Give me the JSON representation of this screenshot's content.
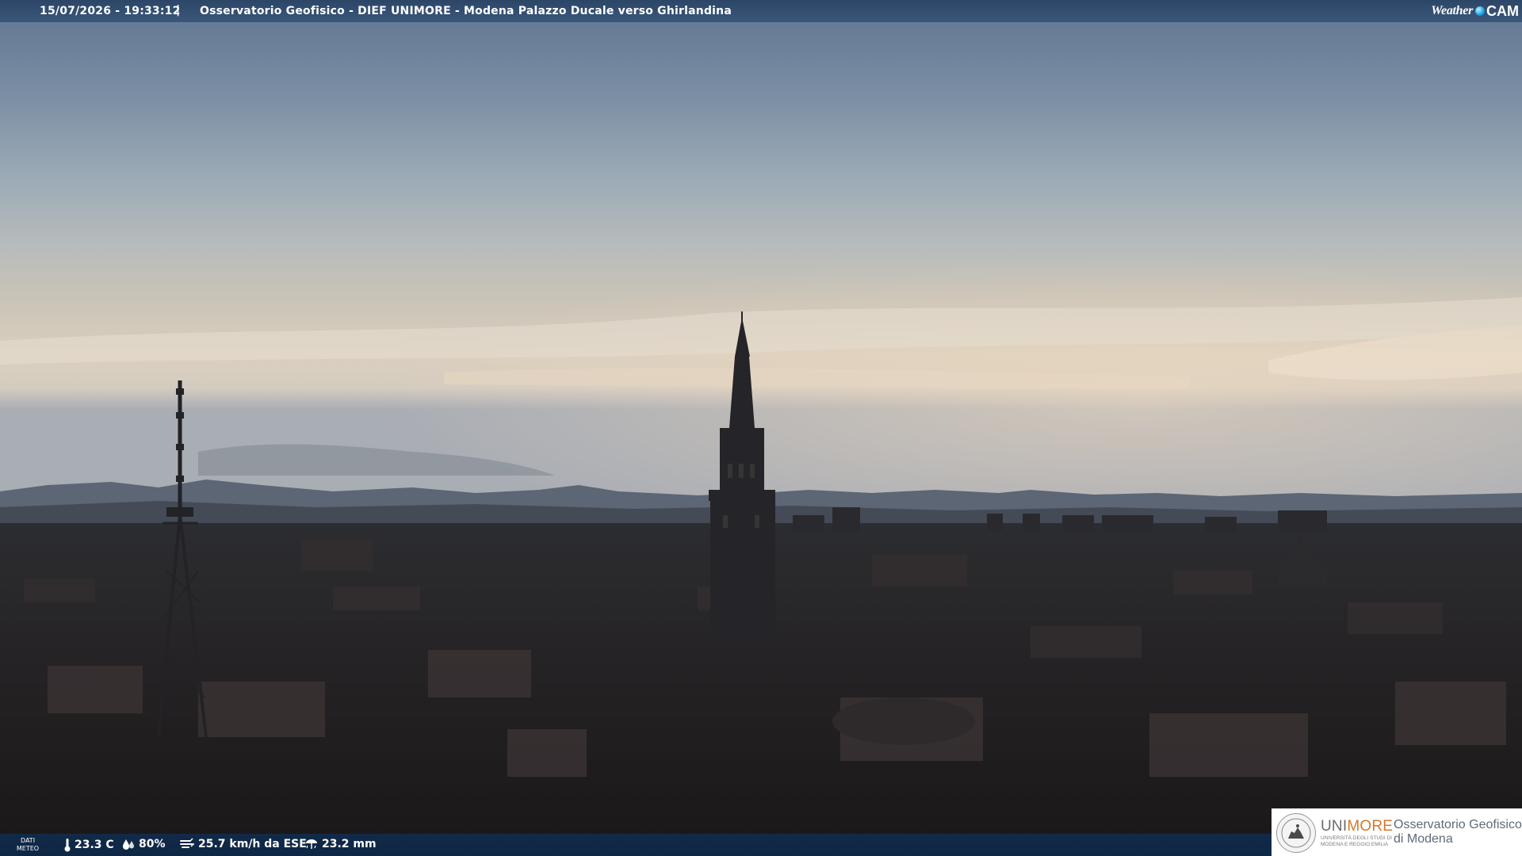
{
  "header": {
    "datetime": "15/07/2026 - 19:33:12",
    "separator": "|",
    "caption": "Osservatorio Geofisico - DIEF UNIMORE - Modena Palazzo Ducale verso Ghirlandina",
    "brand_word": "Weather",
    "brand_cam": "CAM"
  },
  "weather": {
    "dati_line1": "DATI",
    "dati_line2": "METEO",
    "temperature": "23.3 C",
    "humidity": "80%",
    "wind": "25.7 km/h da ESE",
    "rain": "23.2 mm",
    "icons": [
      "thermometer-icon",
      "humidity-drops-icon",
      "wind-icon",
      "rain-gauge-icon"
    ]
  },
  "logo": {
    "uni": "UNI",
    "more": "MORE",
    "sub1": "UNIVERSITÀ DEGLI STUDI DI",
    "sub2": "MODENA E REGGIO EMILIA",
    "obs_line1": "Osservatorio Geofisico",
    "obs_line2": "di Modena"
  },
  "colors": {
    "topbar": "#2e4a70",
    "bottombar": "#102c4e",
    "unimore_orange": "#d4782a"
  }
}
